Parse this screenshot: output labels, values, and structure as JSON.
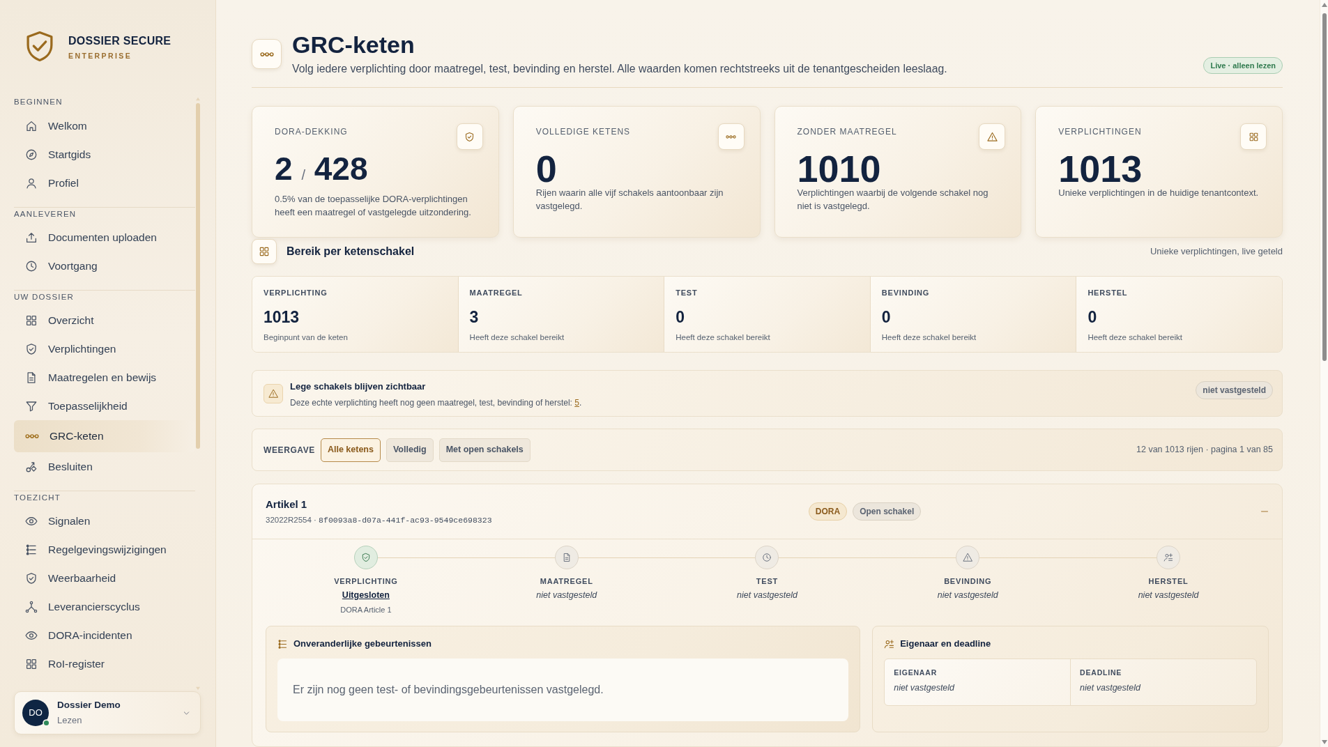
{
  "sidebar": {
    "brand": {
      "name": "DOSSIER SECURE",
      "edition": "ENTERPRISE"
    },
    "sections": [
      {
        "label": "BEGINNEN",
        "items": [
          {
            "label": "Welkom",
            "selected": false
          },
          {
            "label": "Startgids",
            "selected": false
          },
          {
            "label": "Profiel",
            "selected": false
          }
        ]
      },
      {
        "label": "AANLEVEREN",
        "items": [
          {
            "label": "Documenten uploaden",
            "selected": false
          },
          {
            "label": "Voortgang",
            "selected": false
          }
        ]
      },
      {
        "label": "UW DOSSIER",
        "items": [
          {
            "label": "Overzicht",
            "selected": false
          },
          {
            "label": "Verplichtingen",
            "selected": false
          },
          {
            "label": "Maatregelen en bewijs",
            "selected": false
          },
          {
            "label": "Toepasselijkheid",
            "selected": false
          },
          {
            "label": "GRC-keten",
            "selected": true
          },
          {
            "label": "Besluiten",
            "selected": false
          }
        ]
      },
      {
        "label": "TOEZICHT",
        "items": [
          {
            "label": "Signalen",
            "selected": false
          },
          {
            "label": "Regelgevingswijzigingen",
            "selected": false
          },
          {
            "label": "Weerbaarheid",
            "selected": false
          },
          {
            "label": "Leverancierscyclus",
            "selected": false
          },
          {
            "label": "DORA-incidenten",
            "selected": false
          },
          {
            "label": "RoI-register",
            "selected": false
          }
        ]
      }
    ],
    "user": {
      "initials": "DO",
      "name": "Dossier Demo",
      "role": "Lezen",
      "online": true
    }
  },
  "header": {
    "title": "GRC-keten",
    "subtitle": "Volg iedere verplichting door maatregel, test, bevinding en herstel. Alle waarden komen rechtstreeks uit de tenantgescheiden leeslaag.",
    "badge": "Live · alleen lezen"
  },
  "stats": [
    {
      "label": "DORA-DEKKING",
      "value": "2",
      "divider": "/",
      "total": "428",
      "description": "0.5% van de toepasselijke DORA-verplichtingen heeft een maatregel of vastgelegde uitzondering."
    },
    {
      "label": "VOLLEDIGE KETENS",
      "value": "0",
      "description": "Rijen waarin alle vijf schakels aantoonbaar zijn vastgelegd."
    },
    {
      "label": "ZONDER MAATREGEL",
      "value": "1010",
      "description": "Verplichtingen waarbij de volgende schakel nog niet is vastgelegd."
    },
    {
      "label": "VERPLICHTINGEN",
      "value": "1013",
      "description": "Unieke verplichtingen in de huidige tenantcontext."
    }
  ],
  "range": {
    "title": "Bereik per ketenschakel",
    "note": "Unieke verplichtingen, live geteld",
    "stages": [
      {
        "label": "VERPLICHTING",
        "value": "1013",
        "caption": "Beginpunt van de keten"
      },
      {
        "label": "MAATREGEL",
        "value": "3",
        "caption": "Heeft deze schakel bereikt"
      },
      {
        "label": "TEST",
        "value": "0",
        "caption": "Heeft deze schakel bereikt"
      },
      {
        "label": "BEVINDING",
        "value": "0",
        "caption": "Heeft deze schakel bereikt"
      },
      {
        "label": "HERSTEL",
        "value": "0",
        "caption": "Heeft deze schakel bereikt"
      }
    ]
  },
  "notice": {
    "title": "Lege schakels blijven zichtbaar",
    "text": "Deze echte verplichting heeft nog geen maatregel, test, bevinding of herstel: ",
    "link": "5",
    "end": ".",
    "badge": "niet vastgesteld"
  },
  "view": {
    "label": "WEERGAVE",
    "filters": [
      {
        "label": "Alle ketens",
        "selected": true
      },
      {
        "label": "Volledig",
        "selected": false
      },
      {
        "label": "Met open schakels",
        "selected": false
      }
    ],
    "summary": "12 van 1013 rijen · pagina 1 van 85"
  },
  "chains": [
    {
      "title": "Artikel 1",
      "reference": "32022R2554",
      "separator": "·",
      "uuid": "8f0093a8-d07a-441f-ac93-9549ce698323",
      "expanded": true,
      "tags": [
        {
          "label": "DORA",
          "kind": "framework"
        },
        {
          "label": "Open schakel",
          "kind": "status"
        }
      ],
      "steps": [
        {
          "label": "VERPLICHTING",
          "kind": "set",
          "value": "Uitgesloten",
          "note": "DORA Article 1"
        },
        {
          "label": "MAATREGEL",
          "kind": "unset",
          "value": "niet vastgesteld"
        },
        {
          "label": "TEST",
          "kind": "unset",
          "value": "niet vastgesteld"
        },
        {
          "label": "BEVINDING",
          "kind": "unset",
          "value": "niet vastgesteld"
        },
        {
          "label": "HERSTEL",
          "kind": "unset",
          "value": "niet vastgesteld"
        }
      ],
      "events": {
        "title": "Onveranderlijke gebeurtenissen",
        "empty": "Er zijn nog geen test- of bevindingsgebeurtenissen vastgelegd."
      },
      "owner": {
        "title": "Eigenaar en deadline",
        "fields": [
          {
            "label": "EIGENAAR",
            "value": "niet vastgesteld"
          },
          {
            "label": "DEADLINE",
            "value": "niet vastgesteld"
          }
        ]
      }
    }
  ]
}
